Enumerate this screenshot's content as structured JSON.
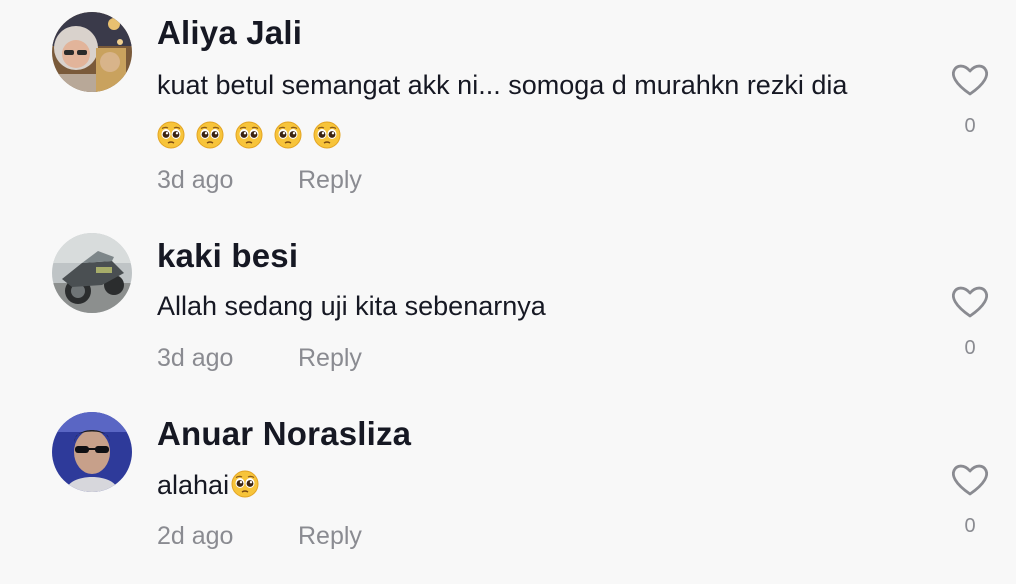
{
  "comments": [
    {
      "username": "Aliya Jali",
      "text": "kuat betul semangat akk ni... somoga d murahkn rezki dia",
      "emoji": "pleading-face-emoji",
      "emoji_count": 5,
      "time": "3d ago",
      "reply_label": "Reply",
      "like_count": "0"
    },
    {
      "username": "kaki besi",
      "text": "Allah sedang uji kita sebenarnya",
      "time": "3d ago",
      "reply_label": "Reply",
      "like_count": "0"
    },
    {
      "username": "Anuar Norasliza",
      "text": "alahai",
      "emoji": "pleading-face-emoji",
      "emoji_count": 1,
      "time": "2d ago",
      "reply_label": "Reply",
      "like_count": "0"
    }
  ],
  "icons": {
    "like": "heart-outline-icon"
  },
  "colors": {
    "background": "#f8f8f8",
    "username": "#161823",
    "text": "#161823",
    "meta": "#8a8b91",
    "heart_stroke": "#8a8b91"
  }
}
